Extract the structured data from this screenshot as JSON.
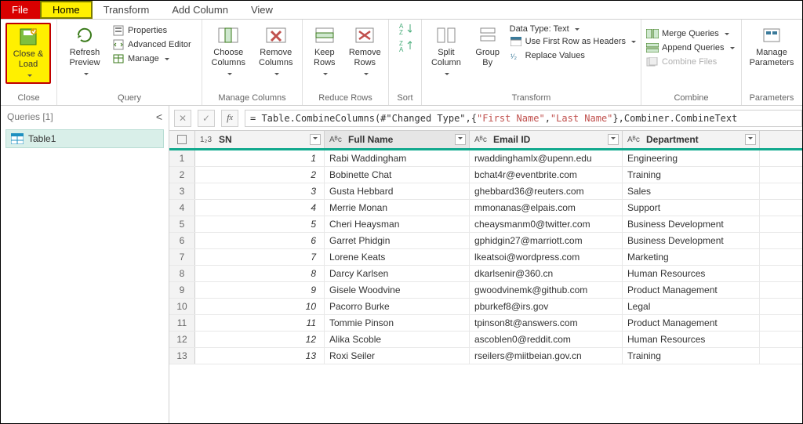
{
  "tabs": {
    "file": "File",
    "home": "Home",
    "transform": "Transform",
    "addcol": "Add Column",
    "view": "View"
  },
  "ribbon": {
    "close": {
      "label": "Close &\nLoad",
      "group": "Close"
    },
    "query": {
      "refresh": "Refresh\nPreview",
      "properties": "Properties",
      "advanced": "Advanced Editor",
      "manage": "Manage",
      "group": "Query"
    },
    "managecols": {
      "choose": "Choose\nColumns",
      "remove": "Remove\nColumns",
      "group": "Manage Columns"
    },
    "reducerows": {
      "keep": "Keep\nRows",
      "removerows": "Remove\nRows",
      "group": "Reduce Rows"
    },
    "sort": {
      "group": "Sort"
    },
    "transform": {
      "split": "Split\nColumn",
      "groupby": "Group\nBy",
      "datatype": "Data Type: Text",
      "firstrowheaders": "Use First Row as Headers",
      "replace": "Replace Values",
      "group": "Transform"
    },
    "combine": {
      "merge": "Merge Queries",
      "append": "Append Queries",
      "files": "Combine Files",
      "group": "Combine"
    },
    "parameters": {
      "manage": "Manage\nParameters",
      "group": "Parameters"
    }
  },
  "queriesPane": {
    "header": "Queries [1]",
    "items": [
      "Table1"
    ]
  },
  "formula": {
    "prefix": "= Table.CombineColumns(#\"Changed Type\",{",
    "s1": "\"First Name\"",
    "comma": ", ",
    "s2": "\"Last Name\"",
    "suffix": "},Combiner.CombineText"
  },
  "columns": {
    "sn_type": "1₂3",
    "sn": "SN",
    "name_type": "Aᴮc",
    "name": "Full Name",
    "email_type": "Aᴮc",
    "email": "Email ID",
    "dept_type": "Aᴮc",
    "dept": "Department"
  },
  "rows": [
    {
      "sn": "1",
      "name": "Rabi Waddingham",
      "email": "rwaddinghamlx@upenn.edu",
      "dept": "Engineering"
    },
    {
      "sn": "2",
      "name": "Bobinette Chat",
      "email": "bchat4r@eventbrite.com",
      "dept": "Training"
    },
    {
      "sn": "3",
      "name": "Gusta Hebbard",
      "email": "ghebbard36@reuters.com",
      "dept": "Sales"
    },
    {
      "sn": "4",
      "name": "Merrie Monan",
      "email": "mmonanas@elpais.com",
      "dept": "Support"
    },
    {
      "sn": "5",
      "name": "Cheri Heaysman",
      "email": "cheaysmanm0@twitter.com",
      "dept": "Business Development"
    },
    {
      "sn": "6",
      "name": "Garret Phidgin",
      "email": "gphidgin27@marriott.com",
      "dept": "Business Development"
    },
    {
      "sn": "7",
      "name": "Lorene Keats",
      "email": "lkeatsoi@wordpress.com",
      "dept": "Marketing"
    },
    {
      "sn": "8",
      "name": "Darcy Karlsen",
      "email": "dkarlsenir@360.cn",
      "dept": "Human Resources"
    },
    {
      "sn": "9",
      "name": "Gisele Woodvine",
      "email": "gwoodvinemk@github.com",
      "dept": "Product Management"
    },
    {
      "sn": "10",
      "name": "Pacorro Burke",
      "email": "pburkef8@irs.gov",
      "dept": "Legal"
    },
    {
      "sn": "11",
      "name": "Tommie Pinson",
      "email": "tpinson8t@answers.com",
      "dept": "Product Management"
    },
    {
      "sn": "12",
      "name": "Alika Scoble",
      "email": "ascoblen0@reddit.com",
      "dept": "Human Resources"
    },
    {
      "sn": "13",
      "name": "Roxi Seiler",
      "email": "rseilers@miitbeian.gov.cn",
      "dept": "Training"
    }
  ]
}
